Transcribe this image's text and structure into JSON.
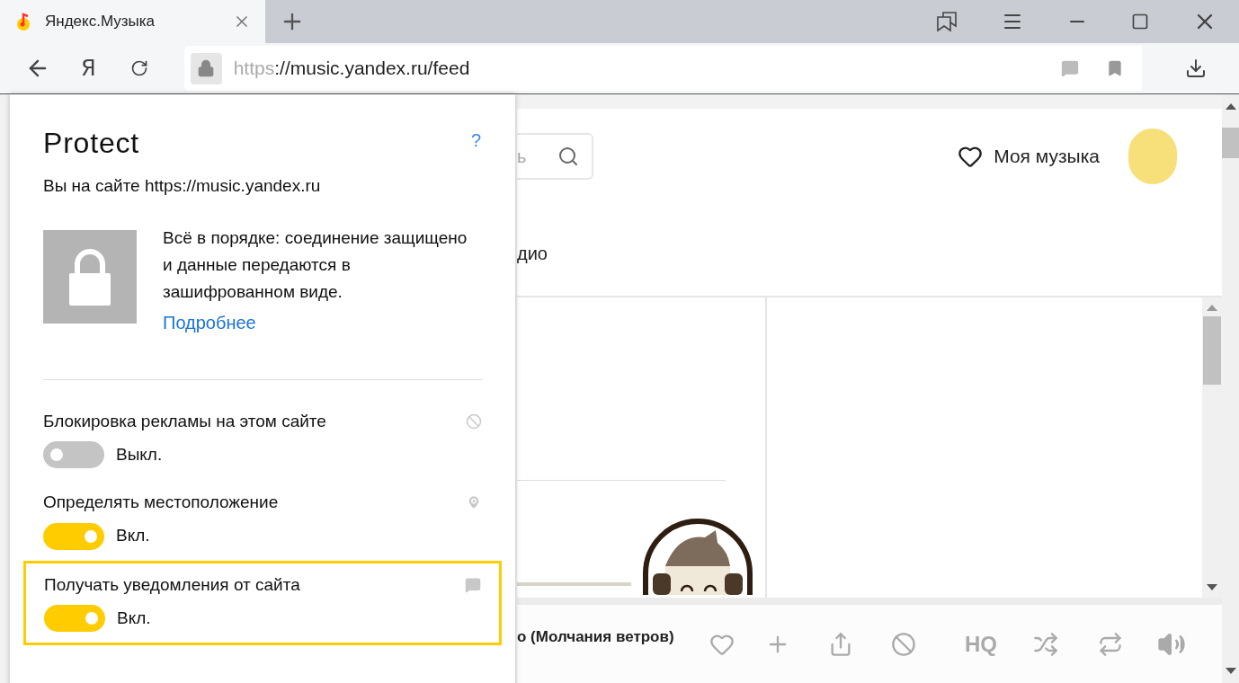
{
  "browser": {
    "tab": {
      "title": "Яндекс.Музыка",
      "selected": true
    },
    "nav": {
      "yandex_key": "Я"
    },
    "address": {
      "scheme": "https",
      "rest": "://music.yandex.ru/feed"
    }
  },
  "page": {
    "search": {
      "placeholder": "ь"
    },
    "my_music": "Моя музыка",
    "nav_fragment": "дио",
    "track_title": "о (Молчания ветров)",
    "quality": "HQ"
  },
  "popup": {
    "logo": "Protect",
    "help": "?",
    "site": "Вы на сайте https://music.yandex.ru",
    "status": "Всё в порядке: соединение защищено и данные передаются в зашифрованном виде.",
    "more_link": "Подробнее",
    "settings": [
      {
        "kind": "block",
        "title": "Блокировка рекламы на этом сайте",
        "on": false,
        "state": "Выкл.",
        "highlighted": false
      },
      {
        "kind": "location",
        "title": "Определять местоположение",
        "on": true,
        "state": "Вкл.",
        "highlighted": false
      },
      {
        "kind": "notify",
        "title": "Получать уведомления от сайта",
        "on": true,
        "state": "Вкл.",
        "highlighted": true
      }
    ]
  }
}
